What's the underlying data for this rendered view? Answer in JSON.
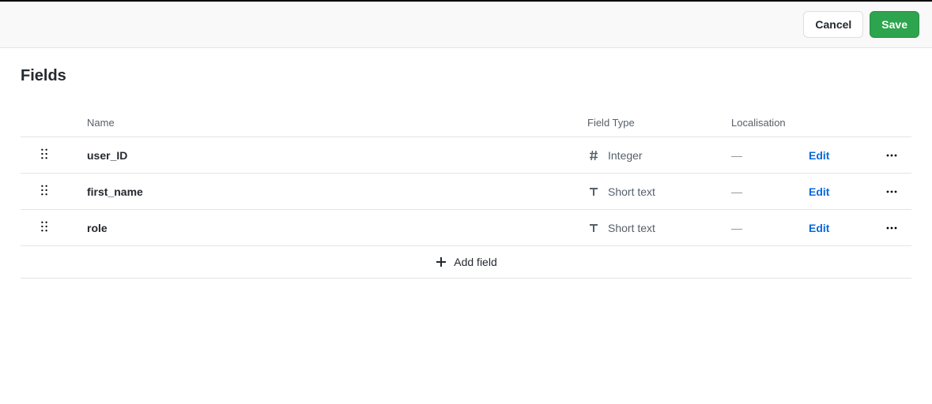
{
  "header": {
    "cancel_label": "Cancel",
    "save_label": "Save"
  },
  "section": {
    "title": "Fields"
  },
  "columns": {
    "name": "Name",
    "type": "Field Type",
    "localisation": "Localisation"
  },
  "rows": [
    {
      "name": "user_ID",
      "type_icon": "hash",
      "type_label": "Integer",
      "localisation": "—",
      "edit_label": "Edit"
    },
    {
      "name": "first_name",
      "type_icon": "text",
      "type_label": "Short text",
      "localisation": "—",
      "edit_label": "Edit"
    },
    {
      "name": "role",
      "type_icon": "text",
      "type_label": "Short text",
      "localisation": "—",
      "edit_label": "Edit"
    }
  ],
  "add_field_label": "Add field"
}
